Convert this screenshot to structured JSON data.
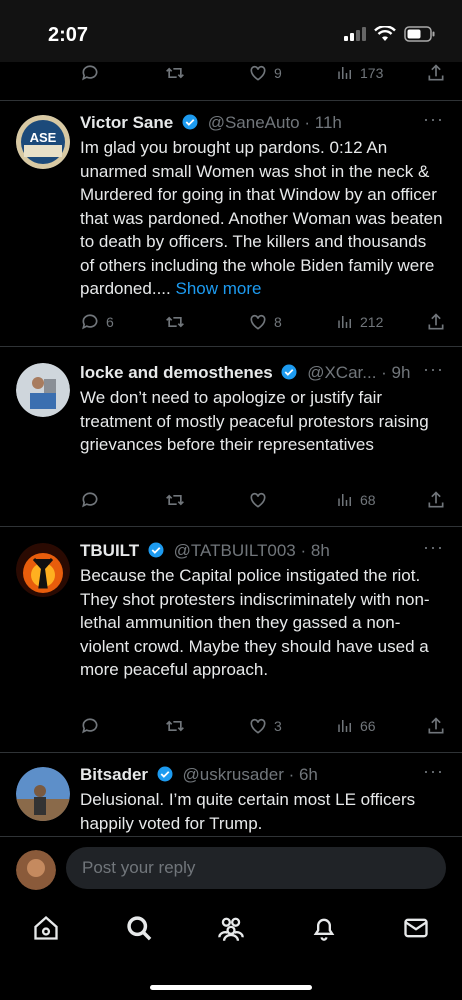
{
  "status_bar": {
    "time": "2:07"
  },
  "top_actions": {
    "likes": "9",
    "views": "173"
  },
  "posts": [
    {
      "name": "Victor Sane",
      "handle": "@SaneAuto",
      "time": "· 11h",
      "text": "Im glad you brought up pardons. 0:12 An unarmed small Women was shot in the neck & Murdered for going in that Window by an officer that was pardoned. Another Woman was beaten to death by officers. The killers and thousands of others including the whole Biden family were pardoned....",
      "show_more": "Show more",
      "replies": "6",
      "likes": "8",
      "views": "212",
      "avatar_text": "ASE"
    },
    {
      "name": "locke and demosthenes",
      "handle": "@XCar...",
      "time": "· 9h",
      "text": "We don’t need to apologize or justify fair treatment of mostly peaceful protestors raising grievances before their representatives",
      "views": "68"
    },
    {
      "name": "TBUILT",
      "handle": "@TATBUILT003",
      "time": "· 8h",
      "text": "Because the Capital police instigated the riot. They shot protesters indiscriminately with non-lethal ammunition then they gassed a non-violent crowd. Maybe they should have used a more peaceful approach.",
      "likes": "3",
      "views": "66"
    },
    {
      "name": "Bitsader",
      "handle": "@uskrusader",
      "time": "· 6h",
      "text": "Delusional.  I’m quite certain most LE officers happily voted for Trump."
    }
  ],
  "reply": {
    "placeholder": "Post your reply"
  },
  "tabs": [
    "home-icon",
    "search-icon",
    "communities-icon",
    "notifications-icon",
    "messages-icon"
  ],
  "colors": {
    "accent": "#1d9bf0",
    "muted": "#71767b",
    "text": "#e7e9ea",
    "background": "#000000"
  }
}
